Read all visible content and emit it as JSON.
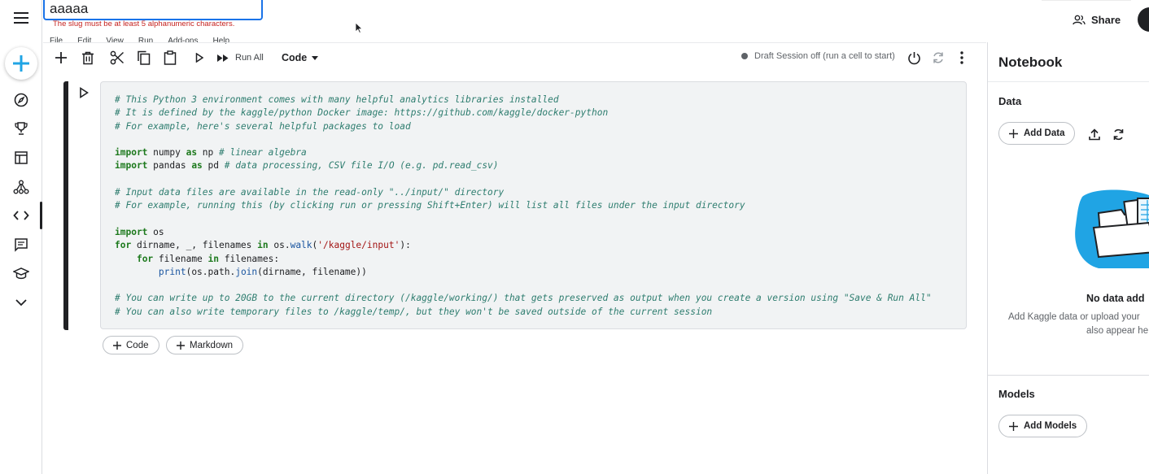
{
  "title_input": {
    "value": "aaaaa"
  },
  "slug_error": "The slug must be at least 5 alphanumeric characters.",
  "menu": [
    "File",
    "Edit",
    "View",
    "Run",
    "Add-ons",
    "Help"
  ],
  "header": {
    "share_label": "Share"
  },
  "toolbar": {
    "run_all_label": "Run All",
    "cell_type": "Code",
    "session_status": "Draft Session off (run a cell to start)"
  },
  "rail": {
    "icons": [
      "menu-icon",
      "add-icon",
      "compass-icon",
      "trophy-icon",
      "table-icon",
      "models-icon",
      "code-icon",
      "discussion-icon",
      "learn-icon",
      "chevron-down-icon"
    ],
    "active": "code-icon"
  },
  "cell": {
    "lines": [
      [
        {
          "t": "cm",
          "v": "# This Python 3 environment comes with many helpful analytics libraries installed"
        }
      ],
      [
        {
          "t": "cm",
          "v": "# It is defined by the kaggle/python Docker image: https://github.com/kaggle/docker-python"
        }
      ],
      [
        {
          "t": "cm",
          "v": "# For example, here's several helpful packages to load"
        }
      ],
      [],
      [
        {
          "t": "kw",
          "v": "import"
        },
        {
          "t": "",
          "v": " numpy "
        },
        {
          "t": "kw",
          "v": "as"
        },
        {
          "t": "",
          "v": " np "
        },
        {
          "t": "cm",
          "v": "# linear algebra"
        }
      ],
      [
        {
          "t": "kw",
          "v": "import"
        },
        {
          "t": "",
          "v": " pandas "
        },
        {
          "t": "kw",
          "v": "as"
        },
        {
          "t": "",
          "v": " pd "
        },
        {
          "t": "cm",
          "v": "# data processing, CSV file I/O (e.g. pd.read_csv)"
        }
      ],
      [],
      [
        {
          "t": "cm",
          "v": "# Input data files are available in the read-only \"../input/\" directory"
        }
      ],
      [
        {
          "t": "cm",
          "v": "# For example, running this (by clicking run or pressing Shift+Enter) will list all files under the input directory"
        }
      ],
      [],
      [
        {
          "t": "kw",
          "v": "import"
        },
        {
          "t": "",
          "v": " os"
        }
      ],
      [
        {
          "t": "kw",
          "v": "for"
        },
        {
          "t": "",
          "v": " dirname, _, filenames "
        },
        {
          "t": "kw",
          "v": "in"
        },
        {
          "t": "",
          "v": " os."
        },
        {
          "t": "fn",
          "v": "walk"
        },
        {
          "t": "",
          "v": "("
        },
        {
          "t": "str",
          "v": "'/kaggle/input'"
        },
        {
          "t": "",
          "v": "):"
        }
      ],
      [
        {
          "t": "",
          "v": "    "
        },
        {
          "t": "kw",
          "v": "for"
        },
        {
          "t": "",
          "v": " filename "
        },
        {
          "t": "kw",
          "v": "in"
        },
        {
          "t": "",
          "v": " filenames:"
        }
      ],
      [
        {
          "t": "",
          "v": "        "
        },
        {
          "t": "fn",
          "v": "print"
        },
        {
          "t": "",
          "v": "(os.path."
        },
        {
          "t": "fn",
          "v": "join"
        },
        {
          "t": "",
          "v": "(dirname, filename))"
        }
      ],
      [],
      [
        {
          "t": "cm",
          "v": "# You can write up to 20GB to the current directory (/kaggle/working/) that gets preserved as output when you create a version using \"Save & Run All\""
        }
      ],
      [
        {
          "t": "cm",
          "v": "# You can also write temporary files to /kaggle/temp/, but they won't be saved outside of the current session"
        }
      ]
    ]
  },
  "add_cell": {
    "code_label": "Code",
    "markdown_label": "Markdown"
  },
  "panel": {
    "title": "Notebook",
    "data_section": "Data",
    "add_data_label": "Add Data",
    "no_data_title": "No data add",
    "no_data_line1": "Add Kaggle data or upload your",
    "no_data_line2": "also appear he",
    "models_section": "Models",
    "add_models_label": "Add Models"
  },
  "colors": {
    "accent": "#1a73e8",
    "fab_plus": "#20a4e4",
    "error": "#c5221f",
    "illustration": "#20a4e4"
  }
}
